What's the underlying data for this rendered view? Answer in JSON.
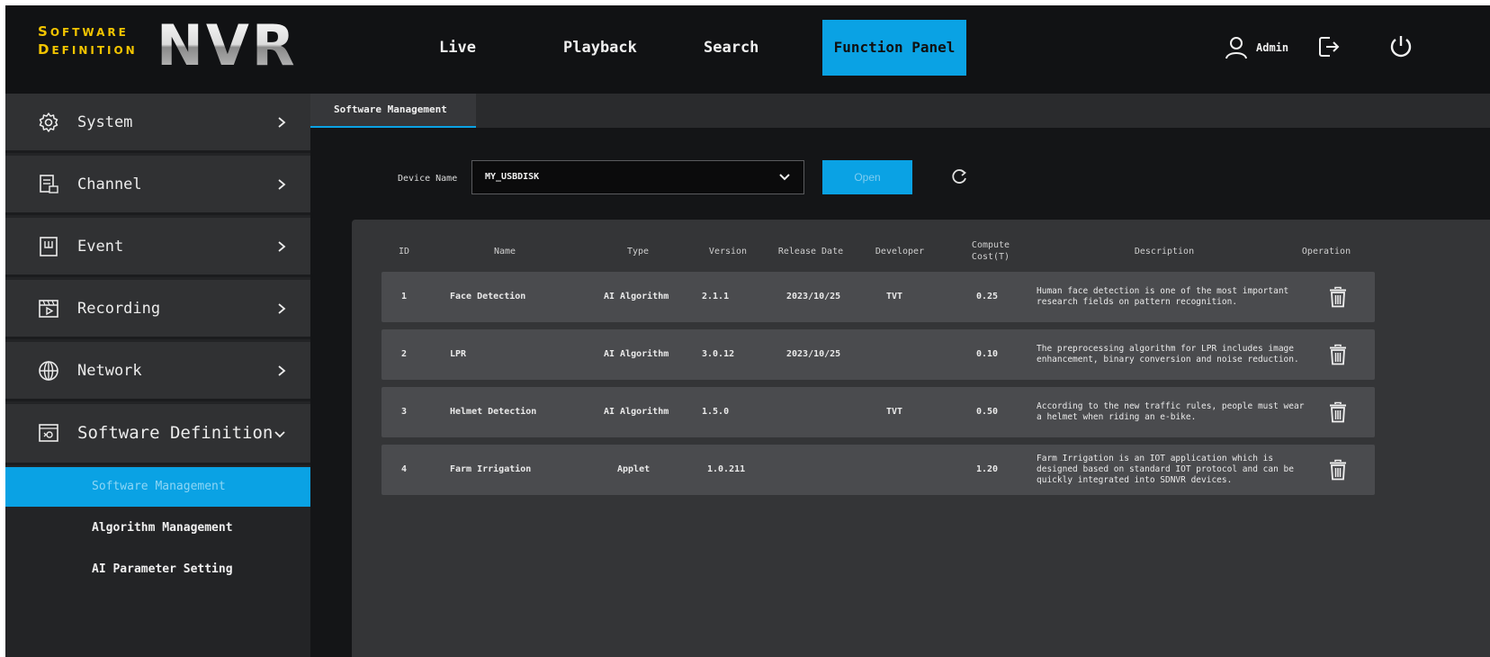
{
  "brand": {
    "line1": "Software",
    "line2": "Definition",
    "product": "NVR"
  },
  "nav": {
    "live": "Live",
    "playback": "Playback",
    "search": "Search",
    "function_panel": "Function Panel"
  },
  "user": {
    "name": "Admin"
  },
  "sidebar": {
    "items": [
      {
        "label": "System",
        "icon": "gear-icon"
      },
      {
        "label": "Channel",
        "icon": "channel-icon"
      },
      {
        "label": "Event",
        "icon": "event-icon"
      },
      {
        "label": "Recording",
        "icon": "recording-icon"
      },
      {
        "label": "Network",
        "icon": "globe-icon"
      },
      {
        "label": "Software Definition",
        "icon": "software-icon"
      }
    ],
    "subitems": [
      {
        "label": "Software Management",
        "active": true
      },
      {
        "label": "Algorithm Management",
        "active": false
      },
      {
        "label": "AI Parameter Setting",
        "active": false
      }
    ]
  },
  "tab": {
    "label": "Software Management"
  },
  "device": {
    "label": "Device Name",
    "value": "MY_USBDISK",
    "open_label": "Open"
  },
  "table": {
    "headers": {
      "id": "ID",
      "name": "Name",
      "type": "Type",
      "version": "Version",
      "release_date": "Release Date",
      "developer": "Developer",
      "compute_line1": "Compute",
      "compute_line2": "Cost(T)",
      "description": "Description",
      "operation": "Operation"
    },
    "rows": [
      {
        "id": "1",
        "name": "Face Detection",
        "type": "AI Algorithm",
        "version": "2.1.1",
        "release_date": "2023/10/25",
        "developer": "TVT",
        "compute": "0.25",
        "description": "Human face detection is one of the most important research fields on pattern recognition."
      },
      {
        "id": "2",
        "name": "LPR",
        "type": "AI Algorithm",
        "version": "3.0.12",
        "release_date": "2023/10/25",
        "developer": "",
        "compute": "0.10",
        "description": "The preprocessing algorithm for LPR includes image enhancement, binary conversion and noise reduction."
      },
      {
        "id": "3",
        "name": "Helmet Detection",
        "type": "AI Algorithm",
        "version": "1.5.0",
        "release_date": "",
        "developer": "TVT",
        "compute": "0.50",
        "description": "According to the new traffic rules, people must wear a helmet when riding an e-bike."
      },
      {
        "id": "4",
        "name": "Farm Irrigation",
        "type": "Applet",
        "version": "1.0.211",
        "release_date": "",
        "developer": "",
        "compute": "1.20",
        "description": "Farm Irrigation is an IOT application which is designed based on standard IOT protocol and can be quickly integrated into SDNVR devices."
      }
    ]
  },
  "colors": {
    "accent": "#0aa2e4",
    "brand_yellow": "#f2c400",
    "background": "#111214",
    "sidebar_item": "#303133",
    "panel": "#343537",
    "row": "#4a4b4e"
  }
}
